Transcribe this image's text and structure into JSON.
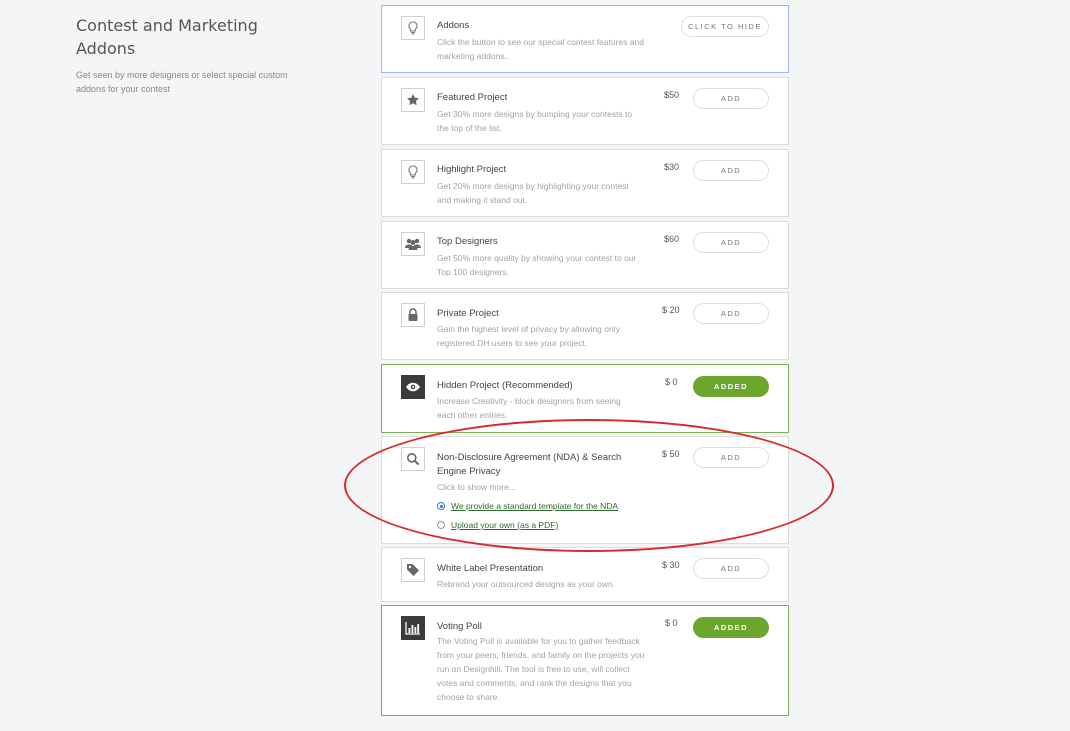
{
  "section": {
    "title_line1": "Contest and Marketing",
    "title_line2": "Addons",
    "description": "Get seen by more designers or select special custom addons for your contest"
  },
  "colors": {
    "accent_green": "#6aa72c",
    "highlight_blue": "#9fb4f5",
    "annotation_red": "#d62a2a"
  },
  "addons_header": {
    "icon": "lightbulb-icon",
    "title": "Addons",
    "description": "Click the button to see our special contest features and marketing addons..",
    "button_label": "CLICK TO HIDE"
  },
  "addons": [
    {
      "icon": "star-icon",
      "title": "Featured Project",
      "description": "Get 30% more designs by bumping your contests to the top of the list.",
      "price": "$50",
      "button_label": "ADD",
      "added": false
    },
    {
      "icon": "lightbulb-icon",
      "title": "Highlight Project",
      "description": "Get 20% more designs by highlighting your contest and making it stand out.",
      "price": "$30",
      "button_label": "ADD",
      "added": false
    },
    {
      "icon": "users-icon",
      "title": "Top Designers",
      "description": "Get 50% more quality by showing your contest to our Top 100 designers.",
      "price": "$60",
      "button_label": "ADD",
      "added": false
    },
    {
      "icon": "lock-icon",
      "title": "Private Project",
      "description": "Gain the highest level of privacy by allowing only registered DH users to see your project.",
      "price": "$ 20",
      "button_label": "ADD",
      "added": false
    },
    {
      "icon": "eye-icon",
      "title": "Hidden Project (Recommended)",
      "description": "Increase Creativity - block designers from seeing each other entries.",
      "price": "$ 0",
      "button_label": "ADDED",
      "added": true
    },
    {
      "icon": "search-icon",
      "title": "Non-Disclosure Agreement (NDA) & Search Engine Privacy",
      "description": "Click to show more...",
      "price": "$ 50",
      "button_label": "ADD",
      "added": false,
      "options": [
        {
          "label": "We provide a standard template for the NDA",
          "selected": true
        },
        {
          "label": "Upload your own (as a PDF)",
          "selected": false
        }
      ]
    },
    {
      "icon": "tag-icon",
      "title": "White Label Presentation",
      "description": "Rebrand your outsourced designs as your own.",
      "price": "$ 30",
      "button_label": "ADD",
      "added": false
    },
    {
      "icon": "bar-chart-icon",
      "title": "Voting Poll",
      "description": "The Voting Poll is available for you to gather feedback from your peers, friends, and family on the projects you run on Designhill. The tool is free to use, will collect votes and comments, and rank the designs that you choose to share.",
      "price": "$ 0",
      "button_label": "ADDED",
      "added": true
    }
  ]
}
